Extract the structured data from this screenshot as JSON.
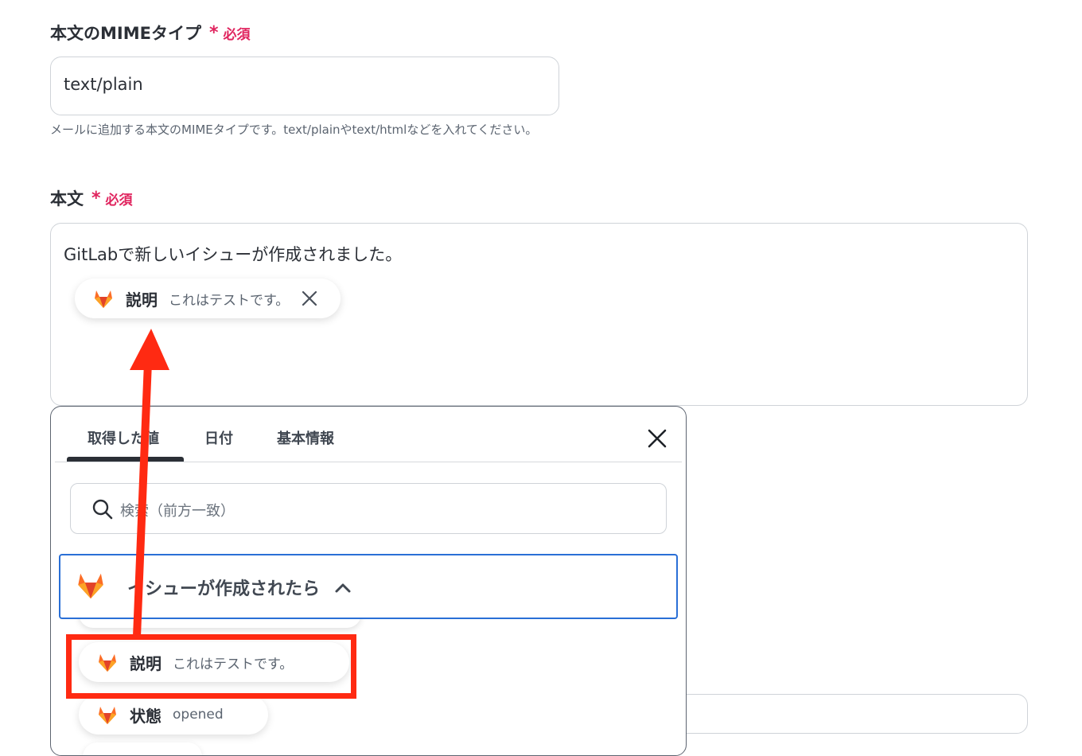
{
  "mime_field": {
    "label": "本文のMIMEタイプ",
    "required_star": "*",
    "required_text": "必須",
    "value": "text/plain",
    "hint": "メールに追加する本文のMIMEタイプです。text/plainやtext/htmlなどを入れてください。"
  },
  "body_field": {
    "label": "本文",
    "required_star": "*",
    "required_text": "必須",
    "text": "GitLabで新しいイシューが作成されました。",
    "chip": {
      "icon": "gitlab-icon",
      "name": "説明",
      "value": "これはテストです。"
    }
  },
  "picker": {
    "tabs": [
      {
        "label": "取得した値",
        "active": true
      },
      {
        "label": "日付",
        "active": false
      },
      {
        "label": "基本情報",
        "active": false
      }
    ],
    "search_placeholder": "検索（前方一致）",
    "group": {
      "icon": "gitlab-icon",
      "title": "イシューが作成されたら",
      "expanded": true
    },
    "items": [
      {
        "icon": "gitlab-icon",
        "name": "説明",
        "value": "これはテストです。"
      },
      {
        "icon": "gitlab-icon",
        "name": "状態",
        "value": "opened"
      }
    ]
  },
  "colors": {
    "required": "#e0245e",
    "annotation": "#ff2a12",
    "focus_border": "#2a6fd6",
    "gitlab_orange": "#fc6d26"
  }
}
